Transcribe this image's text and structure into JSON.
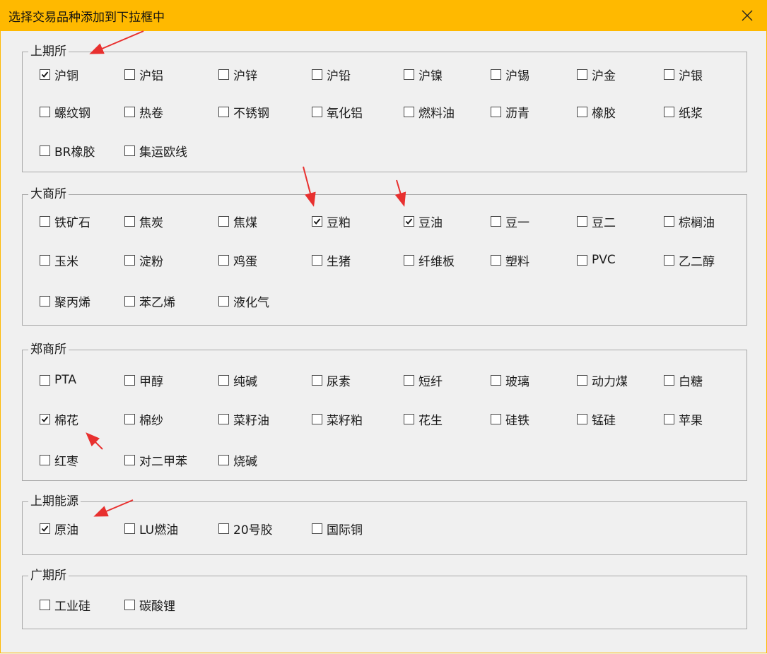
{
  "window": {
    "title": "选择交易品种添加到下拉框中",
    "accent": "#ffb900"
  },
  "groups": [
    {
      "name": "上期所",
      "items": [
        {
          "label": "沪铜",
          "checked": true
        },
        {
          "label": "沪铝",
          "checked": false
        },
        {
          "label": "沪锌",
          "checked": false
        },
        {
          "label": "沪铅",
          "checked": false
        },
        {
          "label": "沪镍",
          "checked": false
        },
        {
          "label": "沪锡",
          "checked": false
        },
        {
          "label": "沪金",
          "checked": false
        },
        {
          "label": "沪银",
          "checked": false
        },
        {
          "label": "螺纹钢",
          "checked": false
        },
        {
          "label": "热卷",
          "checked": false
        },
        {
          "label": "不锈钢",
          "checked": false
        },
        {
          "label": "氧化铝",
          "checked": false
        },
        {
          "label": "燃料油",
          "checked": false
        },
        {
          "label": "沥青",
          "checked": false
        },
        {
          "label": "橡胶",
          "checked": false
        },
        {
          "label": "纸浆",
          "checked": false
        },
        {
          "label": "BR橡胶",
          "checked": false
        },
        {
          "label": "集运欧线",
          "checked": false
        }
      ]
    },
    {
      "name": "大商所",
      "items": [
        {
          "label": "铁矿石",
          "checked": false
        },
        {
          "label": "焦炭",
          "checked": false
        },
        {
          "label": "焦煤",
          "checked": false
        },
        {
          "label": "豆粕",
          "checked": true
        },
        {
          "label": "豆油",
          "checked": true
        },
        {
          "label": "豆一",
          "checked": false
        },
        {
          "label": "豆二",
          "checked": false
        },
        {
          "label": "棕榈油",
          "checked": false
        },
        {
          "label": "玉米",
          "checked": false
        },
        {
          "label": "淀粉",
          "checked": false
        },
        {
          "label": "鸡蛋",
          "checked": false
        },
        {
          "label": "生猪",
          "checked": false
        },
        {
          "label": "纤维板",
          "checked": false
        },
        {
          "label": "塑料",
          "checked": false
        },
        {
          "label": "PVC",
          "checked": false
        },
        {
          "label": "乙二醇",
          "checked": false
        },
        {
          "label": "聚丙烯",
          "checked": false
        },
        {
          "label": "苯乙烯",
          "checked": false
        },
        {
          "label": "液化气",
          "checked": false
        }
      ]
    },
    {
      "name": "郑商所",
      "items": [
        {
          "label": "PTA",
          "checked": false
        },
        {
          "label": "甲醇",
          "checked": false
        },
        {
          "label": "纯碱",
          "checked": false
        },
        {
          "label": "尿素",
          "checked": false
        },
        {
          "label": "短纤",
          "checked": false
        },
        {
          "label": "玻璃",
          "checked": false
        },
        {
          "label": "动力煤",
          "checked": false
        },
        {
          "label": "白糖",
          "checked": false
        },
        {
          "label": "棉花",
          "checked": true
        },
        {
          "label": "棉纱",
          "checked": false
        },
        {
          "label": "菜籽油",
          "checked": false
        },
        {
          "label": "菜籽粕",
          "checked": false
        },
        {
          "label": "花生",
          "checked": false
        },
        {
          "label": "硅铁",
          "checked": false
        },
        {
          "label": "锰硅",
          "checked": false
        },
        {
          "label": "苹果",
          "checked": false
        },
        {
          "label": "红枣",
          "checked": false
        },
        {
          "label": "对二甲苯",
          "checked": false
        },
        {
          "label": "烧碱",
          "checked": false
        }
      ]
    },
    {
      "name": "上期能源",
      "items": [
        {
          "label": "原油",
          "checked": true
        },
        {
          "label": "LU燃油",
          "checked": false
        },
        {
          "label": "20号胶",
          "checked": false
        },
        {
          "label": "国际铜",
          "checked": false
        }
      ]
    },
    {
      "name": "广期所",
      "items": [
        {
          "label": "工业硅",
          "checked": false
        },
        {
          "label": "碳酸锂",
          "checked": false
        }
      ]
    }
  ]
}
